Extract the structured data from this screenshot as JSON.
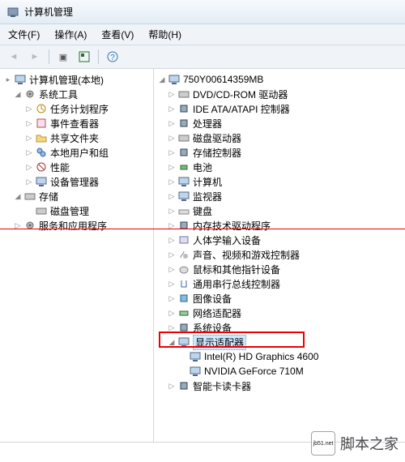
{
  "title": "计算机管理",
  "menu": {
    "file": "文件(F)",
    "action": "操作(A)",
    "view": "查看(V)",
    "help": "帮助(H)"
  },
  "left_tree": {
    "root": "计算机管理(本地)",
    "systools": "系统工具",
    "systools_items": [
      "任务计划程序",
      "事件查看器",
      "共享文件夹",
      "本地用户和组",
      "性能",
      "设备管理器"
    ],
    "storage": "存储",
    "disk_mgmt": "磁盘管理",
    "services": "服务和应用程序"
  },
  "right_tree": {
    "root": "750Y00614359MB",
    "categories": [
      "DVD/CD-ROM 驱动器",
      "IDE ATA/ATAPI 控制器",
      "处理器",
      "磁盘驱动器",
      "存储控制器",
      "电池",
      "计算机",
      "监视器",
      "键盘",
      "内存技术驱动程序",
      "人体学输入设备",
      "声音、视频和游戏控制器",
      "鼠标和其他指针设备",
      "通用串行总线控制器",
      "图像设备",
      "网络适配器",
      "系统设备"
    ],
    "display_adapter": "显示适配器",
    "gpus": [
      "Intel(R) HD Graphics 4600",
      "NVIDIA GeForce 710M"
    ],
    "smartcard": "智能卡读卡器"
  },
  "watermark": {
    "site": "jb51.net",
    "name": "脚本之家"
  }
}
